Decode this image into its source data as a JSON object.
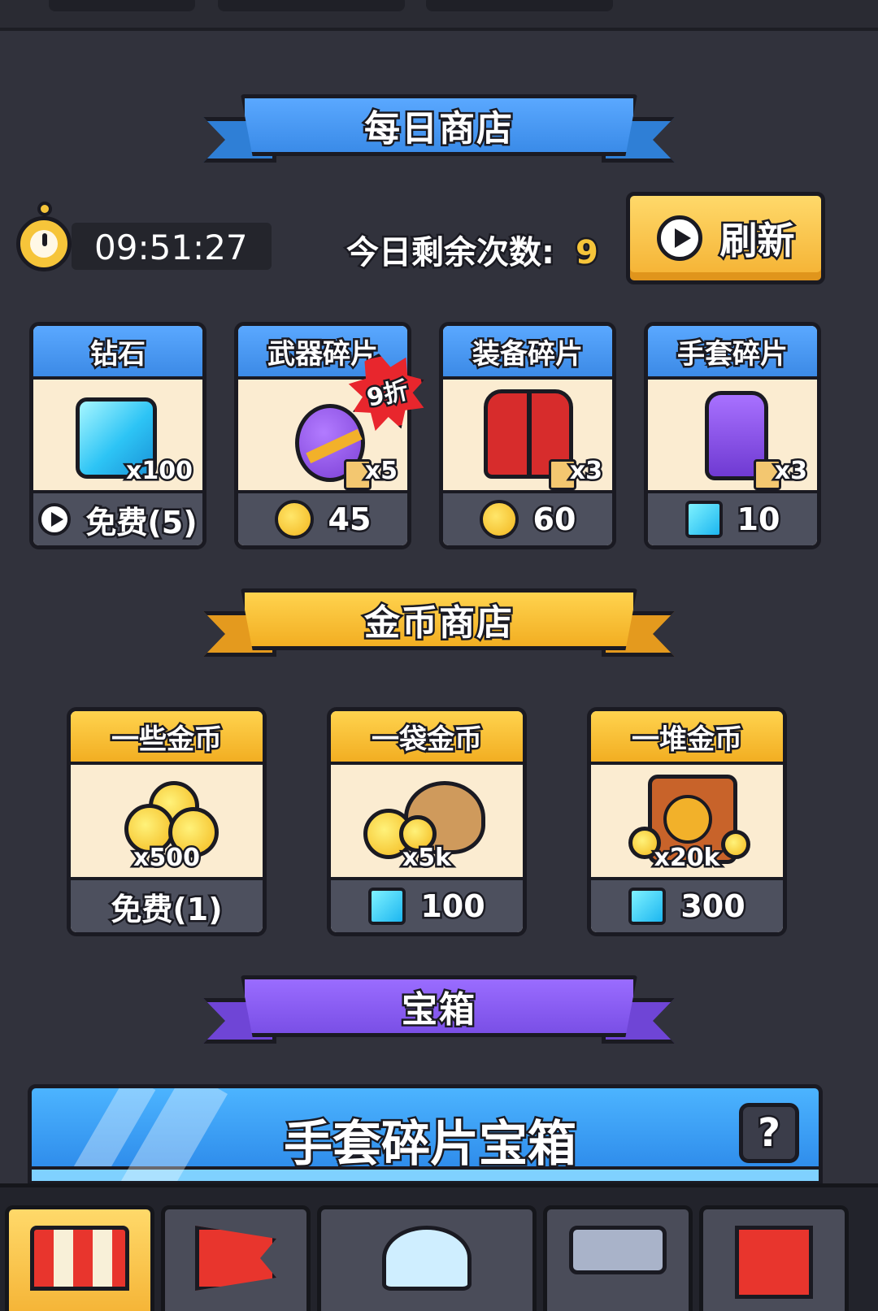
{
  "sections": {
    "daily_title": "每日商店",
    "gold_title": "金币商店",
    "chest_title": "宝箱"
  },
  "daily": {
    "timer": "09:51:27",
    "remaining_label": "今日剩余次数:",
    "remaining_count": "9",
    "refresh_label": "刷新",
    "items": [
      {
        "title": "钻石",
        "qty": "x100",
        "price": "免费(5)",
        "currency": "ad"
      },
      {
        "title": "武器碎片",
        "qty": "x5",
        "price": "45",
        "currency": "coin",
        "badge": "9折"
      },
      {
        "title": "装备碎片",
        "qty": "x3",
        "price": "60",
        "currency": "coin"
      },
      {
        "title": "手套碎片",
        "qty": "x3",
        "price": "10",
        "currency": "gem"
      }
    ]
  },
  "gold": {
    "items": [
      {
        "title": "一些金币",
        "qty": "x500",
        "price": "免费(1)",
        "currency": "none"
      },
      {
        "title": "一袋金币",
        "qty": "x5k",
        "price": "100",
        "currency": "gem"
      },
      {
        "title": "一堆金币",
        "qty": "x20k",
        "price": "300",
        "currency": "gem"
      }
    ]
  },
  "chest": {
    "banner_title": "手套碎片宝箱",
    "help": "?"
  },
  "nav": {
    "tabs": [
      "shop-icon",
      "flag-icon",
      "wings-icon",
      "gun-icon",
      "banner-icon"
    ],
    "active": 0
  },
  "colors": {
    "background": "#31323c",
    "daily_accent": "#3a8be8",
    "gold_accent": "#f2ae22",
    "chest_accent": "#7a4fe6",
    "highlight": "#f6c53a"
  }
}
